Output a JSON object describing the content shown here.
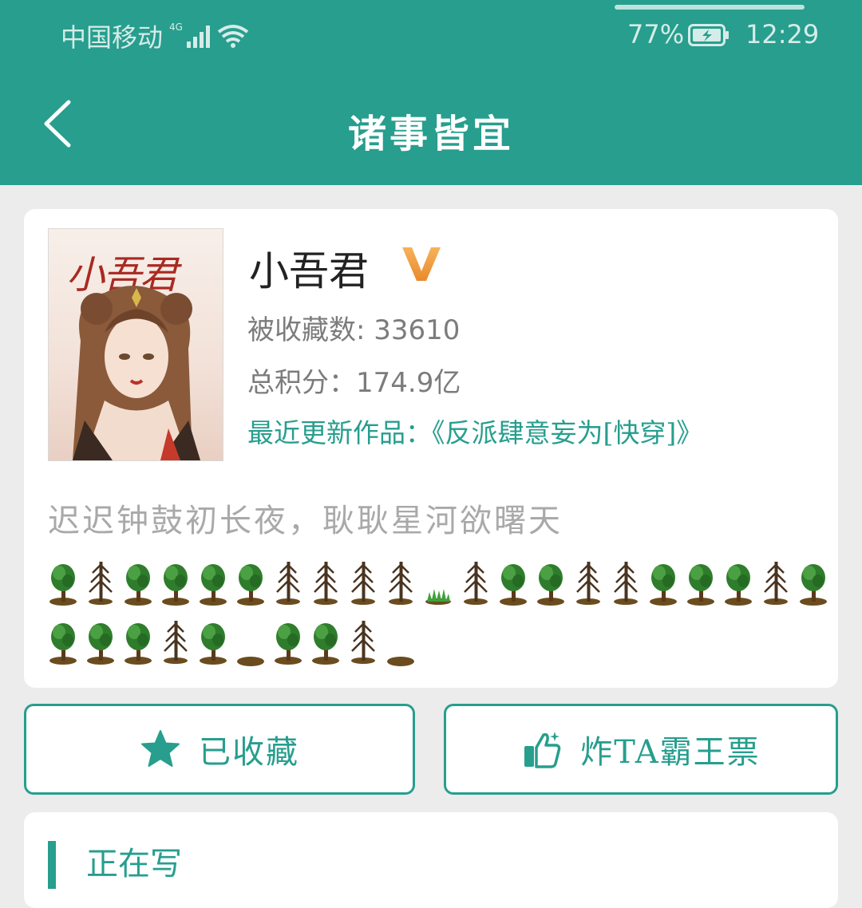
{
  "status_bar": {
    "carrier": "中国移动",
    "network": "4G",
    "battery_percent": "77%",
    "time": "12:29"
  },
  "app_bar": {
    "title": "诸事皆宜",
    "back_icon": "chevron-left-icon"
  },
  "author": {
    "cover_title": "小吾君",
    "name": "小吾君",
    "badge_icon": "vip-v-icon",
    "favorites": "被收藏数: 33610",
    "points": "总积分：174.9亿",
    "recent_work": "最近更新作品：《反派肆意妄为[快穿]》",
    "motto": "迟迟钟鼓初长夜，耿耿星河欲曙天",
    "tree_rows": [
      [
        "tree",
        "pine",
        "tree",
        "tree",
        "tree",
        "tree",
        "pine",
        "pine",
        "pine",
        "pine",
        "grass",
        "pine",
        "tree",
        "tree",
        "pine",
        "pine",
        "tree",
        "tree",
        "tree",
        "pine",
        "tree"
      ],
      [
        "tree",
        "tree",
        "tree",
        "pine",
        "tree",
        "mound",
        "tree",
        "tree",
        "pine",
        "mound"
      ]
    ]
  },
  "actions": {
    "favorite_label": "已收藏",
    "favorite_icon": "star-icon",
    "vote_label": "炸TA霸王票",
    "vote_icon": "thumbs-up-icon"
  },
  "section": {
    "title": "正在写"
  },
  "colors": {
    "primary": "#279e8e",
    "background": "#ececec"
  }
}
